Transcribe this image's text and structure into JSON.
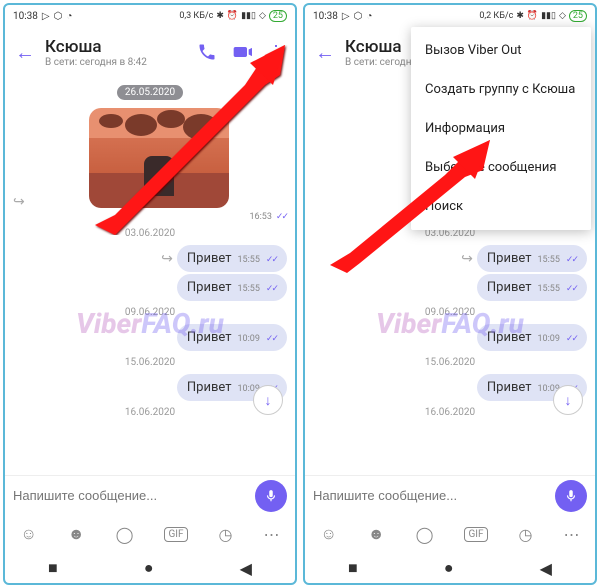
{
  "statusbar": {
    "time": "10:38",
    "net": "0,3 КБ/с",
    "battery": "25"
  },
  "header": {
    "title": "Ксюша",
    "subtitle": "В сети: сегодня в 8:42"
  },
  "dates": {
    "d0": "26.05.2020",
    "d1": "03.06.2020",
    "d2": "09.06.2020",
    "d3": "15.06.2020",
    "d4": "16.06.2020"
  },
  "sticker_time": "16:53",
  "msgs": [
    {
      "text": "Привет",
      "time": "15:55"
    },
    {
      "text": "Привет",
      "time": "15:55"
    },
    {
      "text": "Привет",
      "time": "10:09"
    },
    {
      "text": "Привет",
      "time": "10:09"
    }
  ],
  "input": {
    "placeholder": "Напишите сообщение..."
  },
  "menu": {
    "items": [
      "Вызов Viber Out",
      "Создать группу с Ксюша",
      "Информация",
      "Выберите сообщения",
      "Поиск"
    ]
  },
  "watermark": {
    "a": "Viber",
    "b": "FAQ.ru"
  }
}
